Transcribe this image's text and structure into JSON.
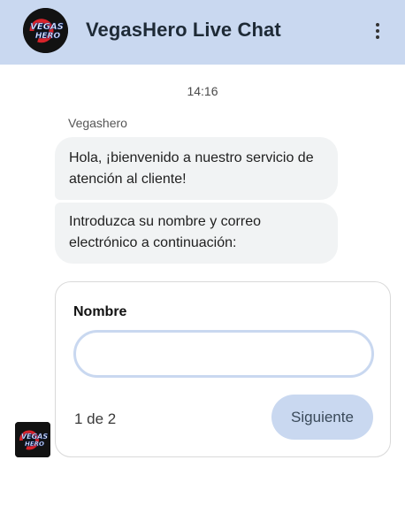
{
  "header": {
    "title": "VegasHero Live Chat",
    "logo_text": "VEGAS HERO",
    "menu_icon": "more-vertical-icon"
  },
  "chat": {
    "timestamp": "14:16",
    "sender": "Vegashero",
    "messages": [
      "Hola, ¡bienvenido a nuestro servicio de atención al cliente!",
      "Introduzca su nombre y correo electrónico a continuación:"
    ]
  },
  "form": {
    "label": "Nombre",
    "value": "",
    "placeholder": "",
    "step": "1 de 2",
    "next_label": "Siguiente"
  },
  "colors": {
    "header_bg": "#c9d8f0",
    "bubble_bg": "#f1f3f4",
    "accent": "#c9d8f0"
  }
}
